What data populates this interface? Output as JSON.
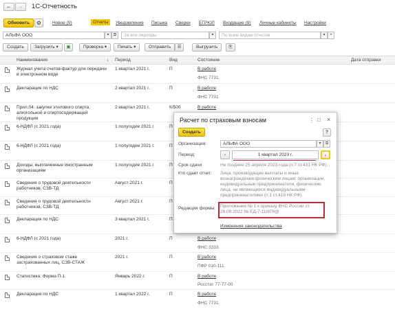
{
  "window": {
    "title": "1С-Отчетность"
  },
  "toolbar1": {
    "refresh": "Обновить",
    "new": "Новое (9)",
    "tabs": [
      "Отчеты",
      "Уведомления",
      "Письма",
      "Сверки",
      "ЕГРЮЛ",
      "Входящие (9)",
      "Личные кабинеты",
      "Настройки"
    ]
  },
  "filters": {
    "org": "АЛЬФА ООО",
    "period_placeholder": "За все периоды",
    "reports_placeholder": "По всем видам отчетов"
  },
  "toolbar2": {
    "create": "Создать",
    "load": "Загрузить",
    "check": "Проверка",
    "print": "Печать",
    "send": "Отправить",
    "unload": "Выгрузить"
  },
  "columns": {
    "name": "Наименование",
    "period": "Период",
    "kind": "Вид",
    "state": "Состояние",
    "date": "Дата отправки"
  },
  "rows": [
    {
      "name": "Журнал учета счетов-фактур для передачи в электронном виде",
      "period": "1 квартал 2021 г.",
      "kind": "П",
      "state": "В работе",
      "agency": "ФНС 7731"
    },
    {
      "name": "Декларация по НДС",
      "period": "2 квартал 2021 г.",
      "kind": "П",
      "state": "В работе",
      "agency": "ФНС 7731"
    },
    {
      "name": "Прил.04: закупки этилового спирта, алкогольной и спиртосодержащей продукции",
      "period": "2 квартал 2021 г.",
      "kind": "К/500",
      "state": "В работе",
      "agency": ""
    },
    {
      "name": "6-НДФЛ (с 2021 года)",
      "period": "1 полугодие 2021 г.",
      "kind": "П",
      "state": "",
      "agency": ""
    },
    {
      "name": "6-НДФЛ (с 2021 года)",
      "period": "1 полугодие 2021 г.",
      "kind": "П",
      "state": "",
      "agency": ""
    },
    {
      "name": "Доходы, выплаченные иностранным организациям",
      "period": "1 полугодие 2021 г.",
      "kind": "П",
      "state": "",
      "agency": ""
    },
    {
      "name": "Сведения о трудовой деятельности работников, СЗВ-ТД",
      "period": "Август 2021 г.",
      "kind": "П",
      "state": "",
      "agency": ""
    },
    {
      "name": "Сведения о трудовой деятельности работников, СЗВ-ТД",
      "period": "Август 2021 г.",
      "kind": "П",
      "state": "",
      "agency": ""
    },
    {
      "name": "Декларация по НДС",
      "period": "3 квартал 2021 г.",
      "kind": "П",
      "state": "",
      "agency": ""
    },
    {
      "name": "6-НДФЛ (с 2021 года)",
      "period": "2021 г.",
      "kind": "П",
      "state": "В работе",
      "agency": "ФНС 3333"
    },
    {
      "name": "Сведения о страховом стаже застрахованных лиц, СЗВ-СТАЖ",
      "period": "2021 г.",
      "kind": "П",
      "state": "В работе",
      "agency": "ПФР 010-111"
    },
    {
      "name": "Статистика: Форма П-1",
      "period": "Январь 2022 г.",
      "kind": "П",
      "state": "В работе",
      "agency": "Росстат 77-77-00"
    },
    {
      "name": "Декларация по НДС",
      "period": "1 квартал 2022 г.",
      "kind": "П",
      "state": "В работе",
      "agency": "ФНС 7731"
    }
  ],
  "dialog": {
    "title": "Расчет по страховым взносам",
    "create": "Создать",
    "help": "?",
    "org_label": "Организация:",
    "org_value": "АЛЬФА ООО",
    "period_label": "Период:",
    "period_value": "1 квартал 2023 г.",
    "deadline_label": "Срок сдачи:",
    "deadline_value": "Не позднее 25 апреля 2023 года (п.7 ст.431 НК РФ).",
    "who_label": "Кто сдает отчет:",
    "who_value": "Лица, производящие выплаты и иные вознаграждения физическим лицам: организации, индивидуальные предприниматели, физические лица, не являющиеся индивидуальными предпринимателями (п.1 ст.419 НК РФ).",
    "edition_label": "Редакция формы:",
    "edition_value": "Приложение № 1 к приказу ФНС России от 29.09.2022 № ЕД-7-11/878@",
    "law_link": "Изменения законодательства"
  },
  "colors": {
    "accent": "#f5c800",
    "highlight_border": "#c0282d",
    "link": "#333333"
  }
}
